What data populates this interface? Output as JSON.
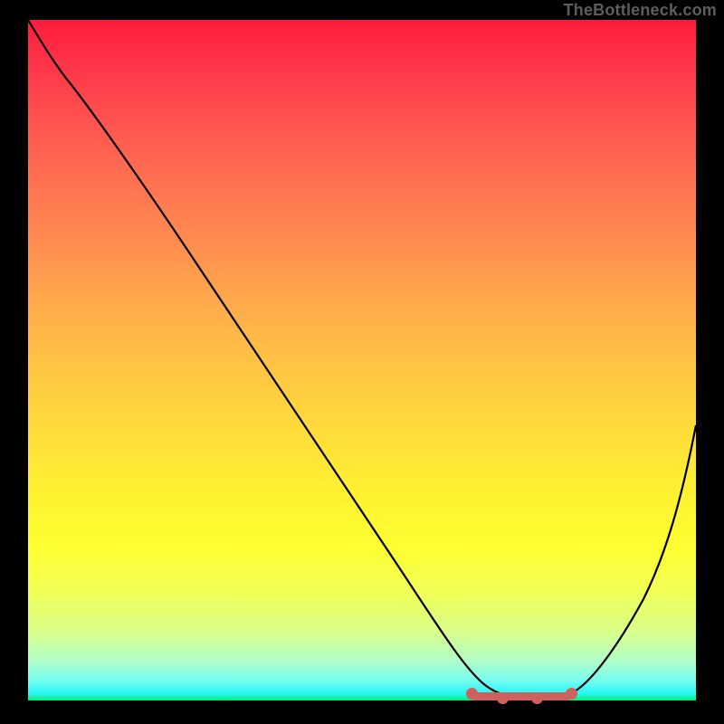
{
  "watermark": "TheBottleneck.com",
  "chart_data": {
    "type": "line",
    "title": "",
    "xlabel": "",
    "ylabel": "",
    "xlim": [
      0,
      100
    ],
    "ylim": [
      0,
      100
    ],
    "grid": false,
    "legend": false,
    "background": "rainbow-gradient-red-to-green",
    "series": [
      {
        "name": "bottleneck-curve",
        "x": [
          0,
          3,
          7,
          12,
          18,
          25,
          32,
          40,
          48,
          55,
          62,
          65,
          68,
          72,
          76,
          80,
          84,
          88,
          92,
          96,
          100
        ],
        "values": [
          100,
          97,
          93,
          87,
          79,
          70,
          61,
          51,
          41,
          31,
          19,
          11,
          5,
          1,
          0,
          0,
          4,
          12,
          21,
          31,
          42
        ]
      }
    ],
    "annotations": [
      {
        "name": "optimal-flat-region",
        "type": "highlight-segment",
        "x_start": 65,
        "x_end": 82,
        "style": "thick-muted-red"
      }
    ],
    "gradient_stops": [
      {
        "pos": 0.0,
        "color": "#fe1b3b"
      },
      {
        "pos": 0.16,
        "color": "#ff5751"
      },
      {
        "pos": 0.32,
        "color": "#ff8a50"
      },
      {
        "pos": 0.5,
        "color": "#ffc244"
      },
      {
        "pos": 0.7,
        "color": "#fff231"
      },
      {
        "pos": 0.84,
        "color": "#f1ff56"
      },
      {
        "pos": 0.94,
        "color": "#b2fec4"
      },
      {
        "pos": 1.0,
        "color": "#00f36e"
      }
    ]
  }
}
